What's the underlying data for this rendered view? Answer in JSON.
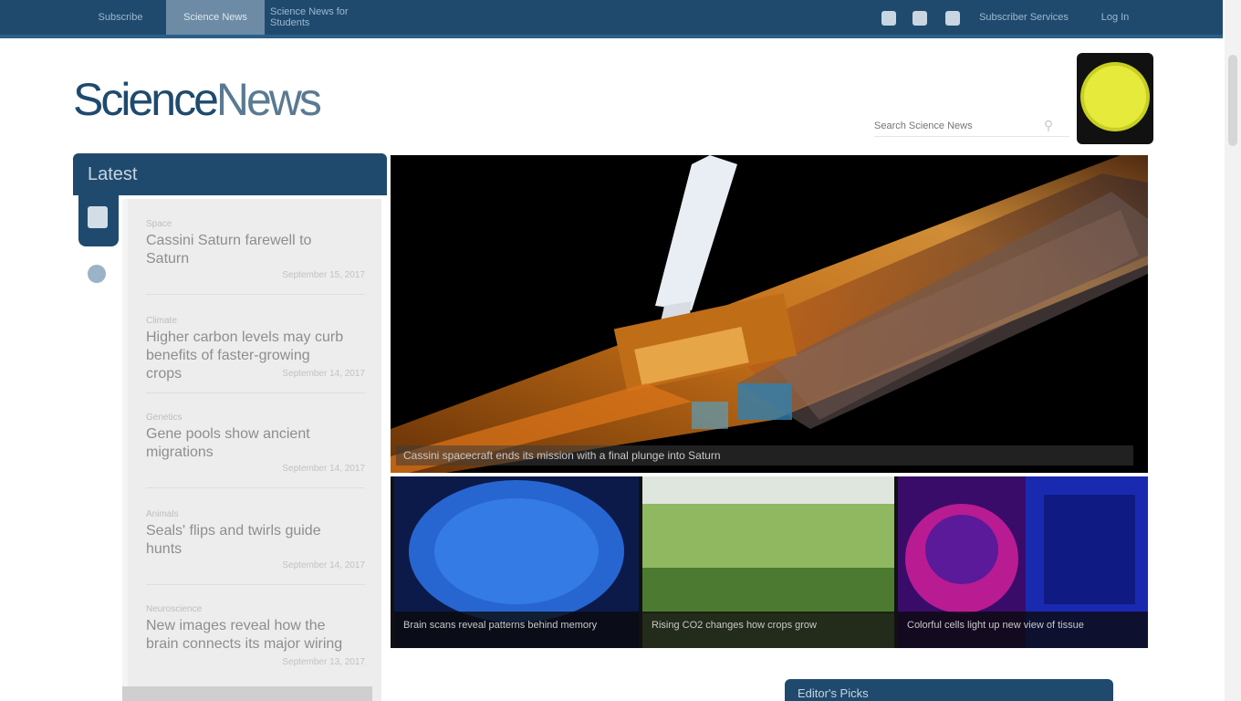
{
  "nav": {
    "items": [
      {
        "label": "Subscribe"
      },
      {
        "label": "Science News"
      },
      {
        "label": "Science News for Students"
      }
    ],
    "right_items": [
      {
        "label": "Subscriber Services"
      },
      {
        "label": "Log In"
      }
    ],
    "social_icons": [
      "facebook-icon",
      "twitter-icon",
      "rss-icon"
    ]
  },
  "logo": {
    "part1": "Science",
    "part2": "News"
  },
  "search": {
    "placeholder": "Search Science News",
    "icon": "search-icon"
  },
  "sidebar": {
    "title": "Latest",
    "items": [
      {
        "kicker": "Space",
        "headline": "Cassini Saturn farewell to Saturn",
        "date": "September 15, 2017"
      },
      {
        "kicker": "Climate",
        "headline": "Higher carbon levels may curb benefits of faster-growing crops",
        "date": "September 14, 2017"
      },
      {
        "kicker": "Genetics",
        "headline": "Gene pools show ancient migrations",
        "date": "September 14, 2017"
      },
      {
        "kicker": "Animals",
        "headline": "Seals' flips and twirls guide hunts",
        "date": "September 14, 2017"
      },
      {
        "kicker": "Neuroscience",
        "headline": "New images reveal how the brain connects its major wiring",
        "date": "September 13, 2017"
      }
    ]
  },
  "hero": {
    "caption": "Cassini spacecraft ends its mission with a final plunge into Saturn"
  },
  "thumbs": [
    {
      "caption": "Brain scans reveal patterns behind memory"
    },
    {
      "caption": "Rising CO2 changes how crops grow"
    },
    {
      "caption": "Colorful cells light up new view of tissue"
    }
  ],
  "box": {
    "title": "Editor's Picks"
  },
  "colors": {
    "nav": "#1f4a6e",
    "accent": "#2c5f88",
    "sidebar_bg": "#ededed"
  }
}
